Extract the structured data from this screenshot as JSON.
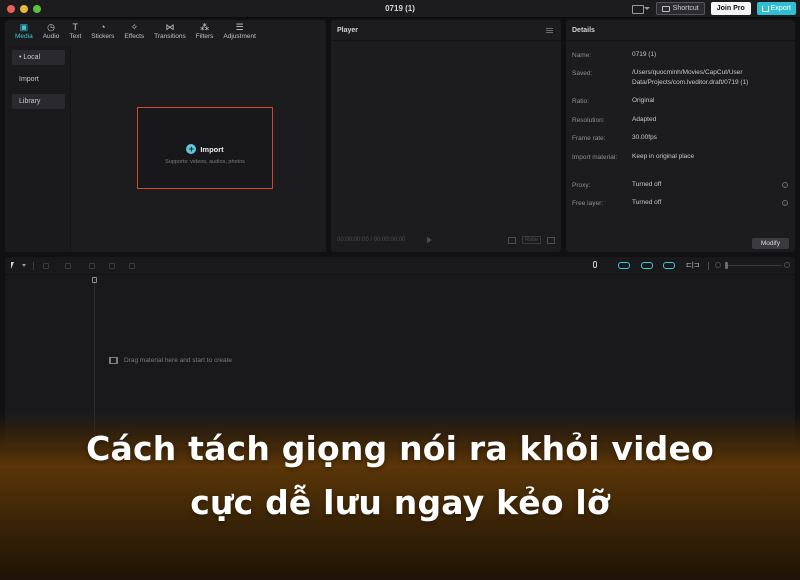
{
  "window": {
    "title": "0719 (1)",
    "shortcut_label": "Shortcut",
    "join_pro_label": "Join Pro",
    "export_label": "Export"
  },
  "media_panel": {
    "tabs": [
      {
        "label": "Media",
        "icon": "media-icon"
      },
      {
        "label": "Audio",
        "icon": "audio-icon"
      },
      {
        "label": "Text",
        "icon": "text-icon"
      },
      {
        "label": "Stickers",
        "icon": "stickers-icon"
      },
      {
        "label": "Effects",
        "icon": "effects-icon"
      },
      {
        "label": "Transitions",
        "icon": "transitions-icon"
      },
      {
        "label": "Filters",
        "icon": "filters-icon"
      },
      {
        "label": "Adjustment",
        "icon": "adjustment-icon"
      }
    ],
    "sidebar": {
      "local": "• Local",
      "import": "Import",
      "library": "Library"
    },
    "import_label": "Import",
    "import_sub": "Supports: videos, audios, photos"
  },
  "player_panel": {
    "title": "Player",
    "timecode": "00:00:00:00 / 00:00:00:00",
    "ratio_label": "Ratio"
  },
  "details_panel": {
    "title": "Details",
    "rows": [
      {
        "label": "Name:",
        "value": "0719 (1)"
      },
      {
        "label": "Saved:",
        "value": "/Users/quocminh/Movies/CapCut/User Data/Projects/com.lveditor.draft/0719 (1)"
      },
      {
        "label": "Ratio:",
        "value": "Original"
      },
      {
        "label": "Resolution:",
        "value": "Adapted"
      },
      {
        "label": "Frame rate:",
        "value": "30.00fps"
      },
      {
        "label": "Import material:",
        "value": "Keep in original place"
      },
      {
        "label": "Proxy:",
        "value": "Turned off"
      },
      {
        "label": "Free layer:",
        "value": "Turned off"
      }
    ],
    "modify_label": "Modify"
  },
  "timeline": {
    "drag_hint": "Drag material here and start to create"
  },
  "banner": {
    "line1": "Cách tách giọng nói ra khỏi video",
    "line2": "cực dễ lưu ngay kẻo lỡ"
  },
  "colors": {
    "accent": "#3ec6d8",
    "import_highlight": "#d6462d",
    "export_button": "#2fbfd2"
  }
}
